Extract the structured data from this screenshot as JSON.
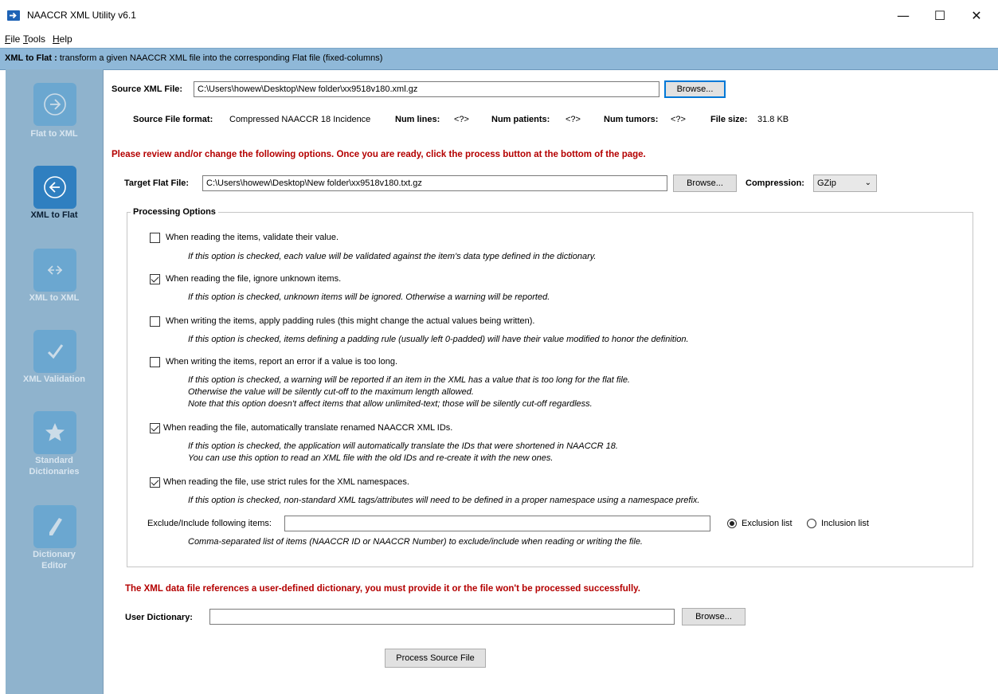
{
  "window": {
    "title": "NAACCR XML Utility v6.1",
    "minimize_glyph": "—",
    "maximize_glyph": "☐",
    "close_glyph": "✕"
  },
  "menu": [
    {
      "accel": "F",
      "rest": "ile"
    },
    {
      "accel": "T",
      "rest": "ools"
    },
    {
      "accel": "H",
      "rest": "elp"
    }
  ],
  "banner": {
    "title": "XML to Flat :",
    "text": "transform a given NAACCR XML file into the corresponding Flat file (fixed-columns)"
  },
  "sidebar": [
    {
      "label": "Flat to XML",
      "icon": "arrow-right-icon",
      "active": false
    },
    {
      "label": "XML to Flat",
      "icon": "arrow-left-icon",
      "active": true
    },
    {
      "label": "XML to XML",
      "icon": "double-arrow-icon",
      "active": false
    },
    {
      "label": "XML Validation",
      "icon": "check-icon",
      "active": false
    },
    {
      "label_line1": "Standard",
      "label_line2": "Dictionaries",
      "icon": "star-icon",
      "active": false
    },
    {
      "label_line1": "Dictionary",
      "label_line2": "Editor",
      "icon": "pencil-icon",
      "active": false
    }
  ],
  "source": {
    "label": "Source XML File:",
    "value": "C:\\Users\\howew\\Desktop\\New folder\\xx9518v180.xml.gz",
    "browse": "Browse..."
  },
  "info": {
    "format_label": "Source File format:",
    "format_value": "Compressed NAACCR 18 Incidence",
    "lines_label": "Num lines:",
    "lines_value": "<?>",
    "patients_label": "Num patients:",
    "patients_value": "<?>",
    "tumors_label": "Num tumors:",
    "tumors_value": "<?>",
    "size_label": "File size:",
    "size_value": "31.8 KB"
  },
  "review_message": "Please review and/or change the following options. Once you are ready, click the process button at the bottom of the page.",
  "target": {
    "label": "Target Flat File:",
    "value": "C:\\Users\\howew\\Desktop\\New folder\\xx9518v180.txt.gz",
    "browse": "Browse...",
    "compression_label": "Compression:",
    "compression_value": "GZip"
  },
  "processing": {
    "legend": "Processing Options",
    "options": [
      {
        "label": "When reading the items, validate their value.",
        "checked": false,
        "desc": [
          "If this option is checked, each value will be validated against the item's data type defined in the dictionary."
        ]
      },
      {
        "label": "When reading the file, ignore unknown items.",
        "checked": true,
        "desc": [
          "If this option is checked, unknown items will be ignored. Otherwise a warning will be reported."
        ]
      },
      {
        "label": "When writing the items, apply padding rules (this might change the actual values being written).",
        "checked": false,
        "desc": [
          "If this option is checked, items defining a padding rule (usually left 0-padded) will have their value modified to honor the definition."
        ]
      },
      {
        "label": "When writing the items, report an error if a value is too long.",
        "checked": false,
        "desc": [
          "If this option is checked, a warning will be reported if an item in the XML has a value that is too long for the flat file.",
          "Otherwise the value will be silently cut-off to the maximum length allowed.",
          "Note that this option doesn't affect items that allow unlimited-text; those will be silently cut-off regardless."
        ]
      },
      {
        "label": "When reading the file, automatically translate renamed NAACCR XML IDs.",
        "checked": true,
        "desc": [
          "If this option is checked, the application will automatically translate the IDs that were shortened in NAACCR 18.",
          "You can use this option to read an XML file with the old IDs and re-create it with the new ones."
        ]
      },
      {
        "label": "When reading the file, use strict rules for the XML namespaces.",
        "checked": true,
        "desc": [
          "If this option is checked, non-standard XML tags/attributes will need to be defined in a proper namespace using a namespace prefix."
        ]
      }
    ],
    "exclude_label": "Exclude/Include following items:",
    "exclude_value": "",
    "exclusion_label": "Exclusion list",
    "inclusion_label": "Inclusion list",
    "exclusion_selected": true,
    "exclude_desc": "Comma-separated list of items (NAACCR ID or NAACCR Number) to exclude/include when reading or writing the file."
  },
  "dictionary_warning": "The XML data file references a user-defined dictionary, you must provide it or the file won't be processed successfully.",
  "user_dictionary": {
    "label": "User Dictionary:",
    "value": "",
    "browse": "Browse..."
  },
  "process_button": "Process Source File"
}
